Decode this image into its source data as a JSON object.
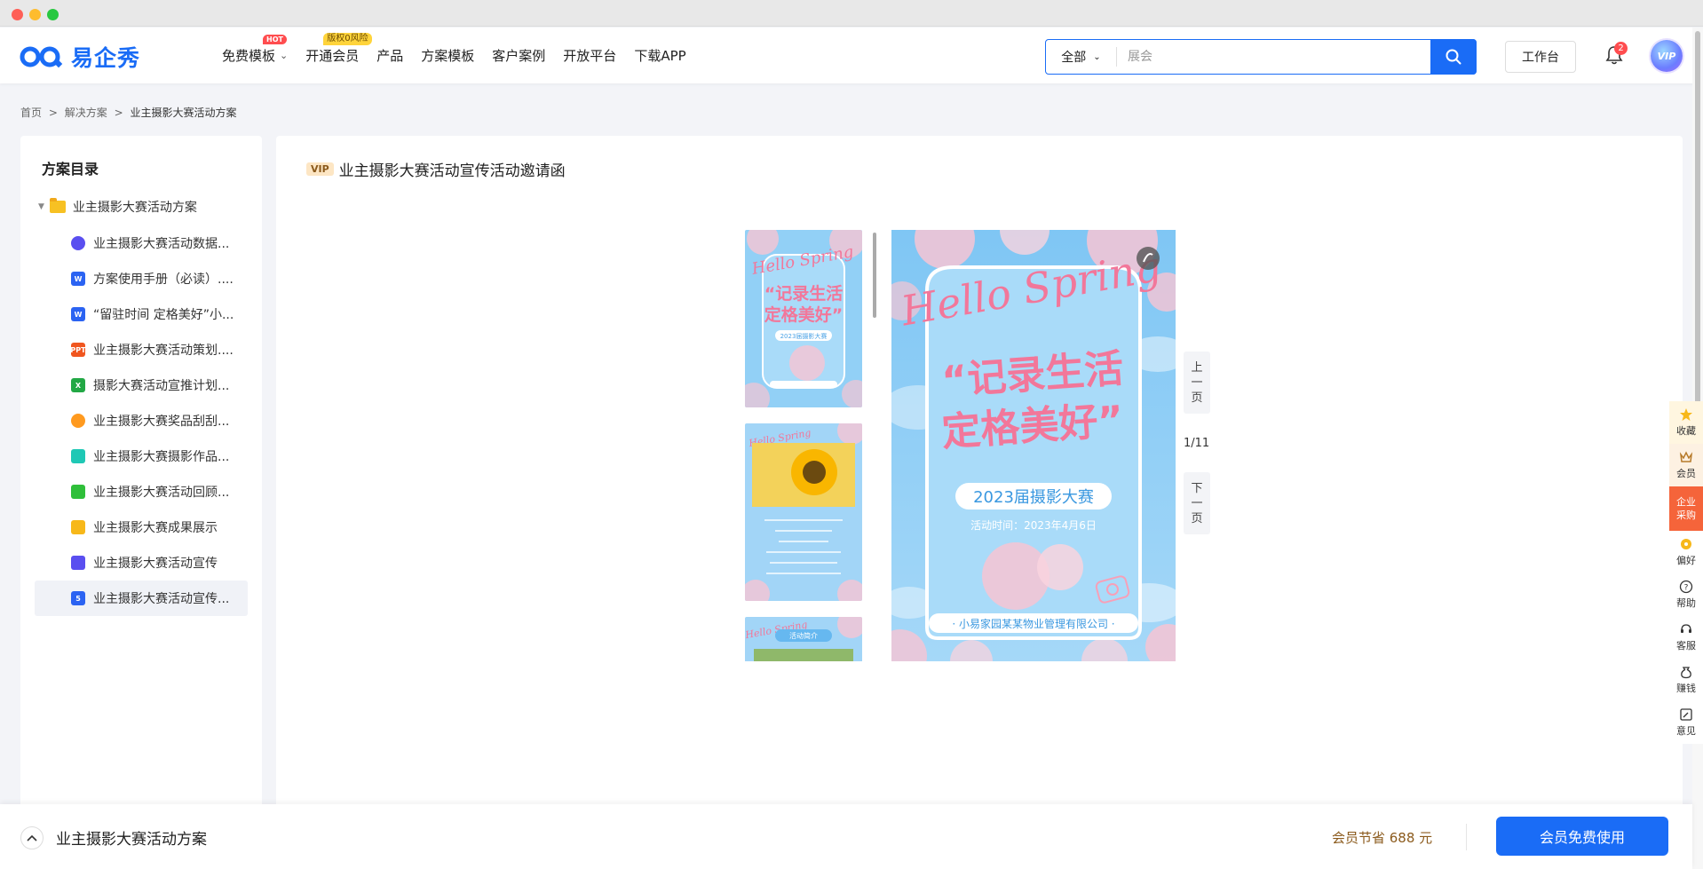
{
  "brand": {
    "name": "易企秀",
    "color": "#1a6cf6"
  },
  "nav": {
    "items": [
      {
        "label": "免费模板",
        "badge": "HOT",
        "dropdown": true
      },
      {
        "label": "开通会员",
        "badge": "版权0风险"
      },
      {
        "label": "产品"
      },
      {
        "label": "方案模板"
      },
      {
        "label": "客户案例"
      },
      {
        "label": "开放平台"
      },
      {
        "label": "下载APP"
      }
    ]
  },
  "search": {
    "scope": "全部",
    "placeholder": "展会"
  },
  "header": {
    "workbench": "工作台",
    "notification_count": "2",
    "avatar_label": "VIP"
  },
  "breadcrumb": [
    "首页",
    ">",
    "解决方案",
    ">",
    "业主摄影大赛活动方案"
  ],
  "sidebar": {
    "title": "方案目录",
    "root": "业主摄影大赛活动方案",
    "items": [
      {
        "label": "业主摄影大赛活动数据...",
        "icon": "pie-chart-icon",
        "color": "#5a4ff0"
      },
      {
        "label": "方案使用手册（必读）....",
        "icon": "word-doc-icon",
        "color": "#2b63f2",
        "glyph": "W"
      },
      {
        "label": "“留驻时间 定格美好”小...",
        "icon": "word-doc-icon",
        "color": "#2b63f2",
        "glyph": "W"
      },
      {
        "label": "业主摄影大赛活动策划....",
        "icon": "ppt-icon",
        "color": "#f0561f",
        "glyph": "PPT"
      },
      {
        "label": "摄影大赛活动宣推计划...",
        "icon": "excel-icon",
        "color": "#22a845",
        "glyph": "X"
      },
      {
        "label": "业主摄影大赛奖品刮刮...",
        "icon": "game-wheel-icon",
        "color": "#ff9a1f"
      },
      {
        "label": "业主摄影大赛摄影作品...",
        "icon": "form-icon",
        "color": "#1fc8b5"
      },
      {
        "label": "业主摄影大赛活动回顾...",
        "icon": "video-icon",
        "color": "#2fbf3a"
      },
      {
        "label": "业主摄影大赛成果展示",
        "icon": "list-doc-icon",
        "color": "#f7b81a"
      },
      {
        "label": "业主摄影大赛活动宣传",
        "icon": "image-icon",
        "color": "#5a4ff0"
      },
      {
        "label": "业主摄影大赛活动宣传...",
        "icon": "h5-icon",
        "color": "#2b63f2",
        "glyph": "5",
        "active": true
      }
    ]
  },
  "document": {
    "vip_tag": "VIP",
    "title": "业主摄影大赛活动宣传活动邀请函",
    "page_indicator": "1/11",
    "prev_label": [
      "上",
      "一",
      "页"
    ],
    "next_label": [
      "下",
      "一",
      "页"
    ]
  },
  "poster": {
    "script_text": "Hello Spring",
    "headline_1": "“记录生活",
    "headline_2": "定格美好”",
    "event": "2023届摄影大赛",
    "time": "活动时间：2023年4月6日",
    "organizer": "· 小易家园某某物业管理有限公司 ·",
    "thumb3_label": "活动简介",
    "colors": {
      "sky": "#8fcff7",
      "pink": "#f2779a",
      "card": "#a8dcfa"
    }
  },
  "rightbar": {
    "items": [
      {
        "label": "收藏",
        "icon": "star-icon"
      },
      {
        "label": "会员",
        "icon": "crown-icon"
      },
      {
        "label": "企业采购",
        "icon": "enterprise-icon"
      },
      {
        "label": "偏好",
        "icon": "preference-icon"
      },
      {
        "label": "帮助",
        "icon": "help-icon"
      },
      {
        "label": "客服",
        "icon": "service-icon"
      },
      {
        "label": "赚钱",
        "icon": "money-bag-icon"
      },
      {
        "label": "意见",
        "icon": "feedback-icon"
      }
    ]
  },
  "bottombar": {
    "title": "业主摄影大赛活动方案",
    "savings": "会员节省 688 元",
    "cta": "会员免费使用"
  }
}
